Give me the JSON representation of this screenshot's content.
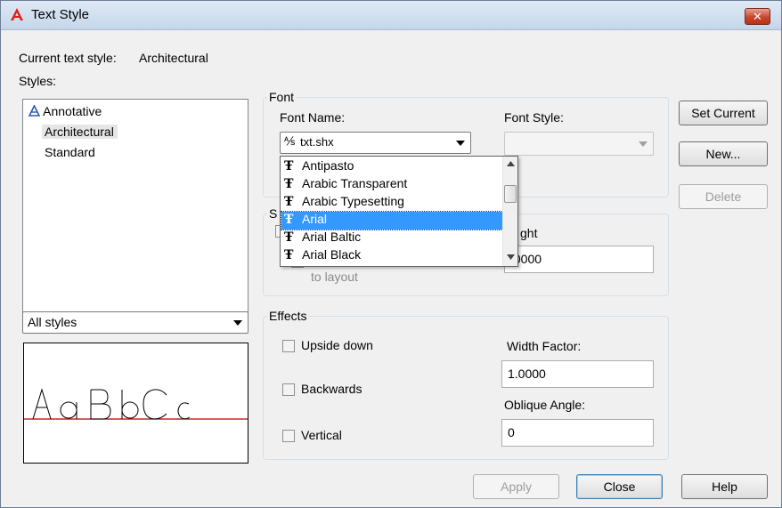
{
  "window": {
    "title": "Text Style",
    "close_label": "✕"
  },
  "current_style": {
    "label": "Current text style:",
    "value": "Architectural"
  },
  "styles": {
    "label": "Styles:",
    "items": [
      "Annotative",
      "Architectural",
      "Standard"
    ],
    "selected": "Architectural",
    "filter": "All styles"
  },
  "font": {
    "group_label": "Font",
    "name_label": "Font Name:",
    "name_value": "txt.shx",
    "style_label": "Font Style:",
    "style_value": "",
    "dropdown_items": [
      "Antipasto",
      "Arabic Transparent",
      "Arabic Typesetting",
      "Arial",
      "Arial Baltic",
      "Arial Black"
    ],
    "dropdown_selected": "Arial"
  },
  "size": {
    "group_label_partial": "S",
    "annotative_partial": "",
    "match_layout_label": "to layout",
    "height_label_partial": "ght",
    "height_value_partial": ".0000"
  },
  "effects": {
    "group_label": "Effects",
    "upside_down": "Upside down",
    "backwards": "Backwards",
    "vertical": "Vertical",
    "width_factor_label": "Width Factor:",
    "width_factor_value": "1.0000",
    "oblique_label": "Oblique Angle:",
    "oblique_value": "0"
  },
  "preview": {
    "text": "AaBbCc"
  },
  "buttons": {
    "set_current": "Set Current",
    "new": "New...",
    "delete": "Delete",
    "apply": "Apply",
    "close": "Close",
    "help": "Help"
  },
  "colors": {
    "selection": "#3399ff",
    "baseline": "#b00000",
    "title_gradient": "#c5d6ea"
  }
}
